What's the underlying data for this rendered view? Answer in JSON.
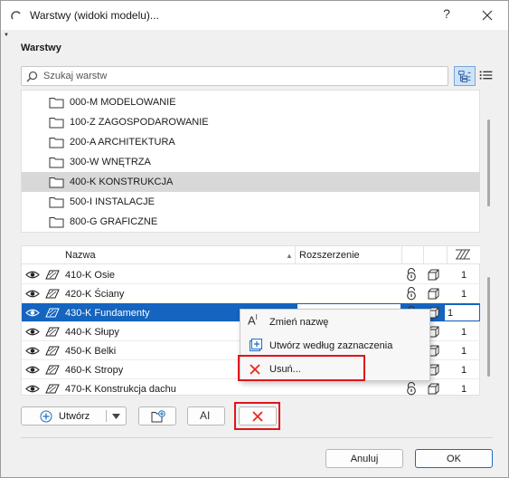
{
  "window": {
    "title": "Warstwy (widoki modelu)...",
    "help_label": "?"
  },
  "section_title": "Warstwy",
  "search": {
    "placeholder": "Szukaj warstw",
    "value": ""
  },
  "combinations": [
    {
      "label": "000-M MODELOWANIE",
      "selected": false
    },
    {
      "label": "100-Z ZAGOSPODAROWANIE",
      "selected": false
    },
    {
      "label": "200-A ARCHITEKTURA",
      "selected": false
    },
    {
      "label": "300-W WNĘTRZA",
      "selected": false
    },
    {
      "label": "400-K KONSTRUKCJA",
      "selected": true
    },
    {
      "label": "500-I INSTALACJE",
      "selected": false
    },
    {
      "label": "800-G GRAFICZNE",
      "selected": false
    }
  ],
  "layer_table": {
    "col_name": "Nazwa",
    "col_extension": "Rozszerzenie",
    "rows": [
      {
        "name": "410-K Osie",
        "intersection": "1",
        "selected": false
      },
      {
        "name": "420-K Ściany",
        "intersection": "1",
        "selected": false
      },
      {
        "name": "430-K Fundamenty",
        "intersection": "1",
        "selected": true
      },
      {
        "name": "440-K Słupy",
        "intersection": "1",
        "selected": false
      },
      {
        "name": "450-K Belki",
        "intersection": "1",
        "selected": false
      },
      {
        "name": "460-K Stropy",
        "intersection": "1",
        "selected": false
      },
      {
        "name": "470-K Konstrukcja dachu",
        "intersection": "1",
        "selected": false
      }
    ]
  },
  "context_menu": {
    "rename": "Zmień nazwę",
    "create_from_selection": "Utwórz według zaznaczenia",
    "delete": "Usuń..."
  },
  "buttons": {
    "create": "Utwórz",
    "rename_glyph": "AI",
    "cancel": "Anuluj",
    "ok": "OK"
  },
  "colors": {
    "selection": "#1464c0",
    "highlight": "#e0141c",
    "delete_icon": "#e8281e"
  }
}
